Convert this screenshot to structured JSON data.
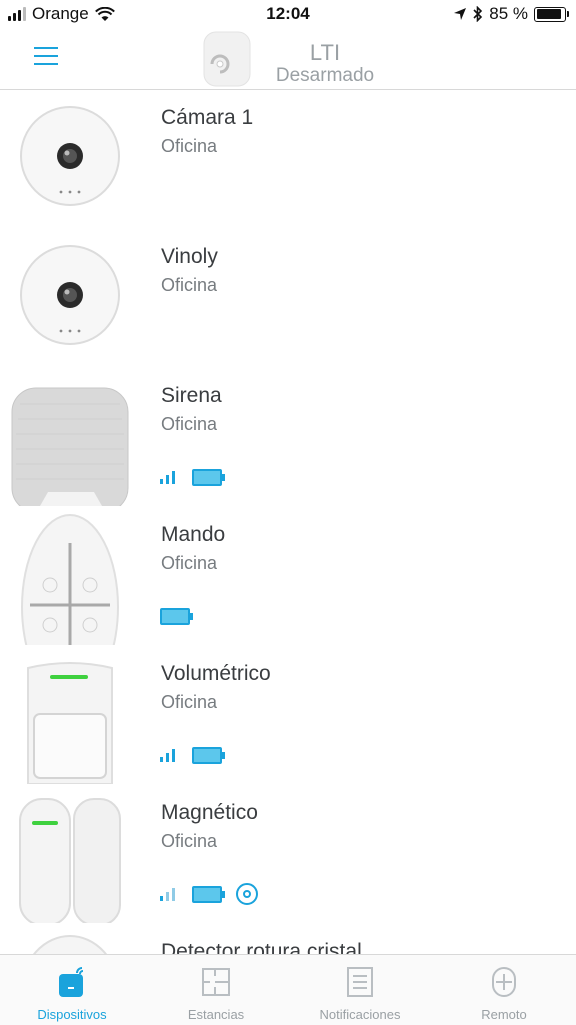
{
  "status_bar": {
    "carrier": "Orange",
    "time": "12:04",
    "battery_percent": "85 %",
    "icons": [
      "signal-icon",
      "wifi-icon",
      "location-arrow-icon",
      "bluetooth-icon",
      "battery-icon"
    ]
  },
  "header": {
    "hub_name": "LTI",
    "hub_status": "Desarmado",
    "menu_icon": "hamburger-menu-icon"
  },
  "devices": [
    {
      "name": "Cámara 1",
      "room": "Oficina",
      "image": "camera",
      "signal": false,
      "battery": false,
      "extra": false
    },
    {
      "name": "Vinoly",
      "room": "Oficina",
      "image": "camera",
      "signal": false,
      "battery": false,
      "extra": false
    },
    {
      "name": "Sirena",
      "room": "Oficina",
      "image": "siren",
      "signal": true,
      "signal_level": 3,
      "battery": true,
      "extra": false
    },
    {
      "name": "Mando",
      "room": "Oficina",
      "image": "keyfob",
      "signal": false,
      "battery": true,
      "extra": false
    },
    {
      "name": "Volumétrico",
      "room": "Oficina",
      "image": "motion",
      "signal": true,
      "signal_level": 3,
      "battery": true,
      "extra": false
    },
    {
      "name": "Magnético",
      "room": "Oficina",
      "image": "door",
      "signal": true,
      "signal_level": 1,
      "battery": true,
      "extra": true
    },
    {
      "name": "Detector rotura cristal",
      "room": "",
      "image": "glass",
      "signal": false,
      "battery": false,
      "extra": false
    }
  ],
  "tabs": [
    {
      "label": "Dispositivos",
      "icon": "devices-icon",
      "active": true
    },
    {
      "label": "Estancias",
      "icon": "rooms-icon",
      "active": false
    },
    {
      "label": "Notificaciones",
      "icon": "notifications-icon",
      "active": false
    },
    {
      "label": "Remoto",
      "icon": "remote-icon",
      "active": false
    }
  ],
  "colors": {
    "accent": "#1aa3dc",
    "text_primary": "#3a3d40",
    "text_secondary": "#777c80",
    "inactive": "#9aa0a4"
  }
}
